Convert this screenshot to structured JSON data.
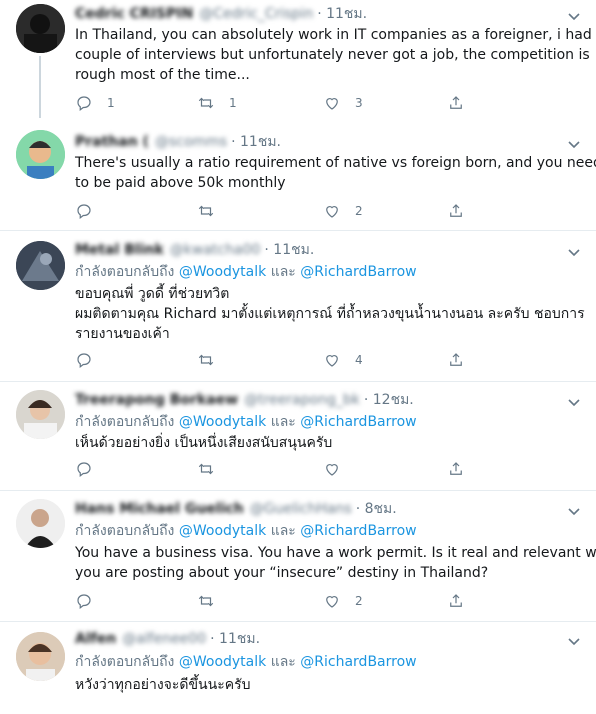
{
  "tweets": [
    {
      "name": "Cedric CRISPIN",
      "handle": "@Cedric_Crispin",
      "time": "11ชม.",
      "reply_prefix": "",
      "mentions": [],
      "lines": [
        "In Thailand, you can absolutely work in IT companies as a foreigner, i had a",
        "couple of interviews but unfortunately never got a job, the competition is",
        "rough most of the time..."
      ],
      "replies": "1",
      "retweets": "1",
      "likes": "3"
    },
    {
      "name": "Prathan (",
      "handle": "@scomms",
      "time": "11ชม.",
      "reply_prefix": "",
      "mentions": [],
      "lines": [
        "There's usually a ratio requirement of native vs foreign born, and you need",
        "to be paid above 50k monthly"
      ],
      "replies": "",
      "retweets": "",
      "likes": "2"
    },
    {
      "name": "Metal Blink",
      "handle": "@kwatcha00",
      "time": "11ชม.",
      "reply_prefix": "กำลังตอบกลับถึง",
      "mentions": [
        "@Woodytalk",
        "และ",
        "@RichardBarrow"
      ],
      "lines": [
        "ขอบคุณพี่ วูดดี้ ที่ช่วยทวิต",
        "ผมติดตามคุณ Richard มาตั้งแต่เหตุการณ์ ที่ถ้ำหลวงขุนน้ำนางนอน ละครับ ชอบการ",
        "รายงานของเค้า"
      ],
      "replies": "",
      "retweets": "",
      "likes": "4"
    },
    {
      "name": "Treerapong Borkaew",
      "handle": "@treerapong_bk",
      "time": "12ชม.",
      "reply_prefix": "กำลังตอบกลับถึง",
      "mentions": [
        "@Woodytalk",
        "และ",
        "@RichardBarrow"
      ],
      "lines": [
        "เห็นด้วยอย่างยิ่ง เป็นหนึ่งเสียงสนับสนุนครับ"
      ],
      "replies": "",
      "retweets": "",
      "likes": ""
    },
    {
      "name": "Hans Michael Guelich",
      "handle": "@GuelichHans",
      "time": "8ชม.",
      "reply_prefix": "กำลังตอบกลับถึง",
      "mentions": [
        "@Woodytalk",
        "และ",
        "@RichardBarrow"
      ],
      "lines": [
        "You have a business visa. You have a work permit. Is it real and relevant what",
        "you are posting about your “insecure” destiny in Thailand?"
      ],
      "replies": "",
      "retweets": "",
      "likes": "2"
    },
    {
      "name": "Alfen",
      "handle": "@alfenee00",
      "time": "11ชม.",
      "reply_prefix": "กำลังตอบกลับถึง",
      "mentions": [
        "@Woodytalk",
        "และ",
        "@RichardBarrow"
      ],
      "lines": [
        "หวังว่าทุกอย่างจะดีขึ้นนะครับ"
      ],
      "replies": "",
      "retweets": "",
      "likes": ""
    }
  ],
  "icons": {
    "reply": "reply-icon",
    "retweet": "retweet-icon",
    "like": "heart-icon",
    "share": "share-icon",
    "more": "chevron-down-icon"
  },
  "colors": {
    "link": "#1b95e0",
    "muted": "#657786",
    "text": "#14171a",
    "divider": "#e6ecf0"
  }
}
